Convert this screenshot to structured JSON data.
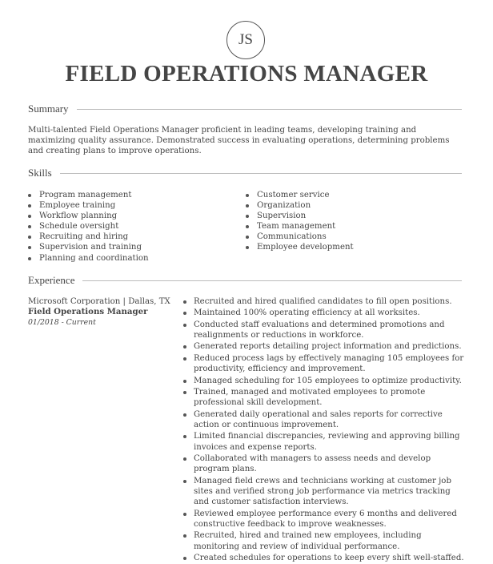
{
  "header": {
    "initials": "JS",
    "name": "FIELD OPERATIONS MANAGER"
  },
  "summary": {
    "title": "Summary",
    "text": "Multi-talented Field Operations Manager proficient in leading teams, developing training and maximizing quality assurance. Demonstrated success in evaluating operations, determining problems and creating plans to improve operations."
  },
  "skills": {
    "title": "Skills",
    "left": [
      "Program management",
      "Employee training",
      "Workflow planning",
      "Schedule oversight",
      "Recruiting and hiring",
      "Supervision and training",
      "Planning and coordination"
    ],
    "right": [
      "Customer service",
      "Organization",
      "Supervision",
      "Team management",
      "Communications",
      "Employee development"
    ]
  },
  "experience": {
    "title": "Experience",
    "jobs": [
      {
        "company_location": "Microsoft Corporation | Dallas, TX",
        "job_title": "Field Operations Manager",
        "dates": "01/2018 - Current",
        "bullets": [
          "Recruited and hired qualified candidates to fill open positions.",
          "Maintained 100% operating efficiency at all worksites.",
          "Conducted staff evaluations and determined promotions and realignments or reductions in workforce.",
          "Generated reports detailing project information and predictions.",
          "Reduced process lags by effectively managing 105 employees for productivity, efficiency and improvement.",
          "Managed scheduling for 105 employees to optimize productivity.",
          "Trained, managed and motivated employees to promote professional skill development.",
          "Generated daily operational and sales reports for corrective action or continuous improvement.",
          "Limited financial discrepancies, reviewing and approving billing invoices and expense reports.",
          "Collaborated with managers to assess needs and develop program plans.",
          "Managed field crews and technicians working at customer job sites and verified strong job performance via metrics tracking and customer satisfaction interviews.",
          "Reviewed employee performance every 6 months and delivered constructive feedback to improve weaknesses.",
          "Recruited, hired and trained new employees, including monitoring and review of individual performance.",
          "Created schedules for operations to keep every shift well-staffed."
        ]
      }
    ]
  }
}
